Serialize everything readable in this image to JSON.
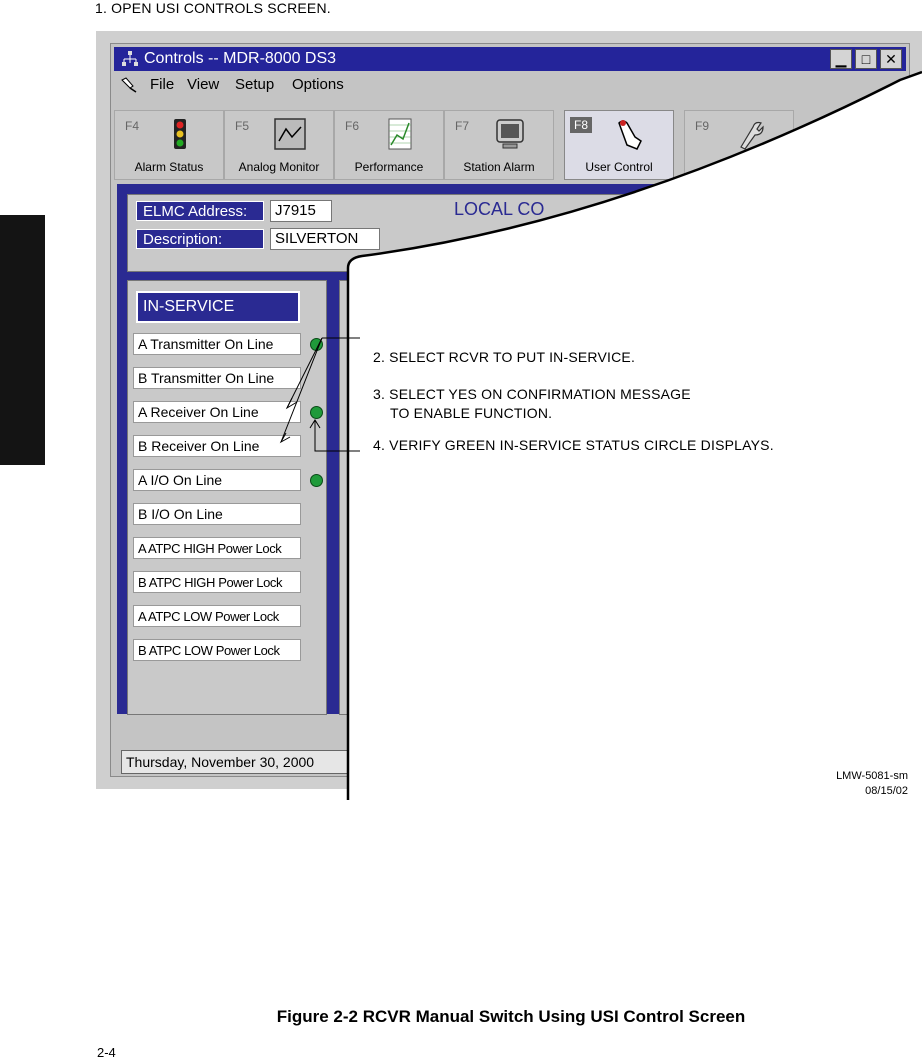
{
  "step1": "1.  OPEN USI CONTROLS SCREEN.",
  "window": {
    "title": "Controls -- MDR-8000 DS3",
    "minimize": "▁",
    "maximize": "□",
    "close": "✕"
  },
  "menu": [
    "File",
    "View",
    "Setup",
    "Options"
  ],
  "fkeys": [
    {
      "key": "F4",
      "label": "Alarm Status",
      "icon": "traffic-light-icon"
    },
    {
      "key": "F5",
      "label": "Analog Monitor",
      "icon": "oscilloscope-icon"
    },
    {
      "key": "F6",
      "label": "Performance",
      "icon": "chart-icon"
    },
    {
      "key": "F7",
      "label": "Station Alarm",
      "icon": "monitor-icon"
    },
    {
      "key": "F8",
      "label": "User Control",
      "icon": "hand-pointer-icon"
    },
    {
      "key": "F9",
      "label": "",
      "icon": "wrench-icon"
    }
  ],
  "header": {
    "elmc_label": "ELMC Address:",
    "elmc_value": "J7915",
    "desc_label": "Description:",
    "desc_value": "SILVERTON",
    "title": "LOCAL CO"
  },
  "inservice": {
    "title": "IN-SERVICE",
    "items": [
      "A Transmitter On Line",
      "B Transmitter On Line",
      "A Receiver On Line",
      "B Receiver On Line",
      "A I/O On Line",
      "B I/O On Line",
      "A ATPC HIGH Power Lock",
      "B ATPC HIGH Power Lock",
      "A ATPC LOW Power Lock",
      "B ATPC LOW Power Lock"
    ]
  },
  "date": "Thursday, November 30, 2000",
  "instructions": {
    "step2": "2.  SELECT RCVR TO PUT IN-SERVICE.",
    "step3a": "3.  SELECT YES ON CONFIRMATION MESSAGE",
    "step3b": "TO ENABLE FUNCTION.",
    "step4": "4.  VERIFY GREEN IN-SERVICE STATUS CIRCLE DISPLAYS."
  },
  "figure_code": "LMW-5081-sm",
  "figure_date": "08/15/02",
  "caption": "Figure 2-2  RCVR Manual Switch Using USI Control Screen",
  "page_number": "2-4",
  "colors": {
    "window_blue": "#24249a",
    "panel_blue": "#2a2a92",
    "status_green": "#1f9a3a"
  }
}
